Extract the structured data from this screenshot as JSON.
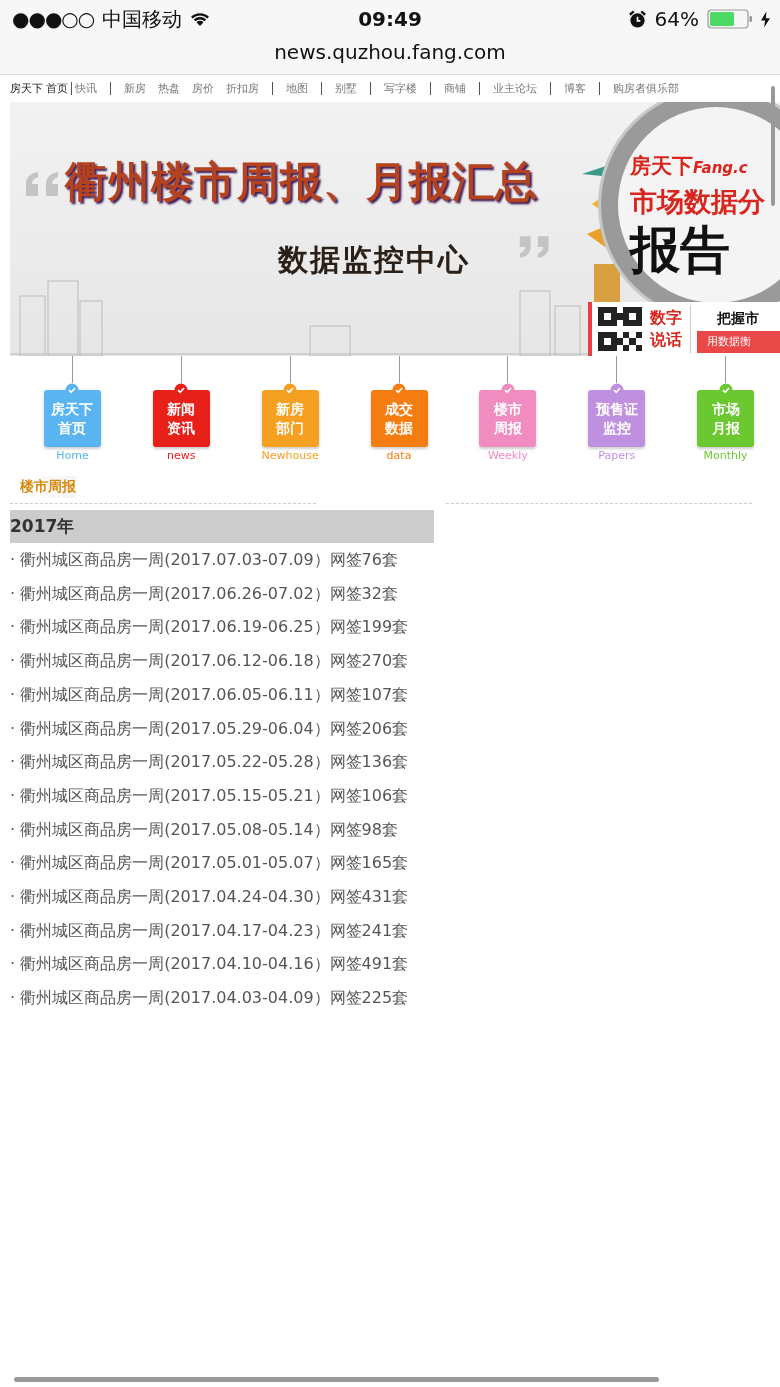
{
  "status_bar": {
    "signal": "●●●○○",
    "carrier": "中国移动",
    "time": "09:49",
    "battery": "64%"
  },
  "address_bar": {
    "url": "news.quzhou.fang.com"
  },
  "site_nav": [
    [
      "房天下 首页"
    ],
    [
      "快讯"
    ],
    [
      "新房",
      "热盘",
      "房价",
      "折扣房"
    ],
    [
      "地图"
    ],
    [
      "别墅"
    ],
    [
      "写字楼"
    ],
    [
      "商铺"
    ],
    [
      "业主论坛"
    ],
    [
      "博客"
    ],
    [
      "购房者俱乐部"
    ]
  ],
  "banner": {
    "title": "衢州楼市周报、月报汇总",
    "subtitle": "数据监控中心",
    "brand": "房天下",
    "brand_en": "Fang.c",
    "report_title": "市场数据分",
    "report_big": "报告",
    "slogan_top": "数字",
    "slogan_bottom": "说话",
    "tagline_top": "把握市",
    "tagline_bottom": "用数据衡"
  },
  "tiles": [
    {
      "lines": [
        "房天下",
        "首页"
      ],
      "label": "Home",
      "color": "#5ab4f0"
    },
    {
      "lines": [
        "新闻",
        "资讯"
      ],
      "label": "news",
      "color": "#e8201a"
    },
    {
      "lines": [
        "新房",
        "部门"
      ],
      "label": "Newhouse",
      "color": "#f5a020"
    },
    {
      "lines": [
        "成交",
        "数据"
      ],
      "label": "data",
      "color": "#f57c10"
    },
    {
      "lines": [
        "楼市",
        "周报"
      ],
      "label": "Weekly",
      "color": "#f08cc0"
    },
    {
      "lines": [
        "预售证",
        "监控"
      ],
      "label": "Papers",
      "color": "#c090e0"
    },
    {
      "lines": [
        "市场",
        "月报"
      ],
      "label": "Monthly",
      "color": "#6cc830"
    }
  ],
  "section_title": "楼市周报",
  "year": "2017年",
  "reports": [
    "· 衢州城区商品房一周(2017.07.03-07.09）网签76套",
    "· 衢州城区商品房一周(2017.06.26-07.02）网签32套",
    "· 衢州城区商品房一周(2017.06.19-06.25）网签199套",
    "· 衢州城区商品房一周(2017.06.12-06.18）网签270套",
    "· 衢州城区商品房一周(2017.06.05-06.11）网签107套",
    "· 衢州城区商品房一周(2017.05.29-06.04）网签206套",
    "· 衢州城区商品房一周(2017.05.22-05.28）网签136套",
    "· 衢州城区商品房一周(2017.05.15-05.21）网签106套",
    "· 衢州城区商品房一周(2017.05.08-05.14）网签98套",
    "· 衢州城区商品房一周(2017.05.01-05.07）网签165套",
    "· 衢州城区商品房一周(2017.04.24-04.30）网签431套",
    "· 衢州城区商品房一周(2017.04.17-04.23）网签241套",
    "· 衢州城区商品房一周(2017.04.10-04.16）网签491套",
    "· 衢州城区商品房一周(2017.04.03-04.09）网签225套"
  ]
}
